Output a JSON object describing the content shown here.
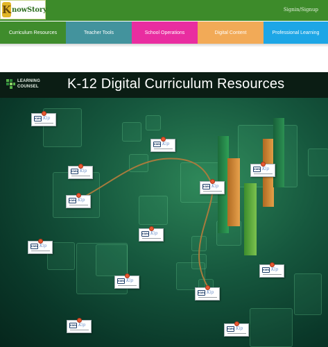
{
  "header": {
    "logo_letter": "K",
    "logo_text": "nowStory",
    "signin": "Signin/Signup"
  },
  "nav": {
    "tabs": [
      {
        "label": "Curriculum Resources",
        "color": "#3f8c2c"
      },
      {
        "label": "Teacher Tools",
        "color": "#43939d"
      },
      {
        "label": "School Operations",
        "color": "#e92da0"
      },
      {
        "label": "Digital Content",
        "color": "#f2aa57"
      },
      {
        "label": "Professional Learning",
        "color": "#1da6e6"
      }
    ]
  },
  "banner": {
    "title": "K-12 Digital Curriculum Resources",
    "org_line1": "LEARNING",
    "org_line2": "COUNSEL"
  },
  "pins": {
    "badge": "KMN",
    "script": "Kip"
  }
}
